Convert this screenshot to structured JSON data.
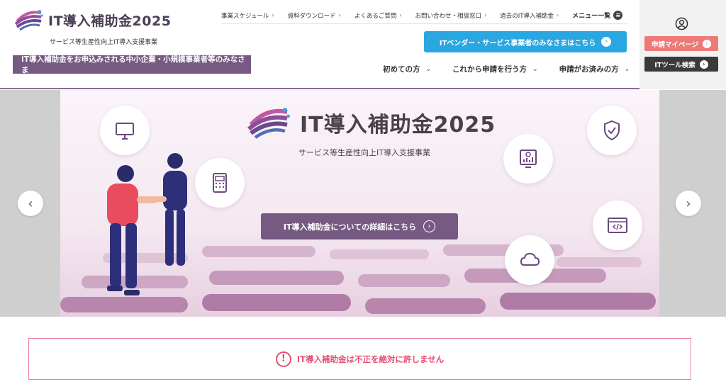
{
  "header": {
    "logo_text": "IT導入補助金2025",
    "logo_sub": "サービス等生産性向上IT導入支援事業",
    "audience_label": "IT導入補助金をお申込みされる中小企業・小規模事業者等のみなさま",
    "top_nav": [
      {
        "label": "事業スケジュール"
      },
      {
        "label": "資料ダウンロード"
      },
      {
        "label": "よくあるご質問"
      },
      {
        "label": "お問い合わせ・相談窓口"
      },
      {
        "label": "過去のIT導入補助金"
      }
    ],
    "menu_label": "メニュー一覧",
    "vendor_button": "ITベンダー・サービス事業者のみなさまはこちら",
    "main_nav": [
      {
        "label": "初めての方"
      },
      {
        "label": "これから申請を行う方"
      },
      {
        "label": "申請がお済みの方"
      }
    ],
    "mypage_button": "申請マイページ",
    "toolsearch_button": "ITツール検索"
  },
  "hero": {
    "title": "IT導入補助金2025",
    "subtitle": "サービス等生産性向上IT導入支援事業",
    "detail_button": "IT導入補助金についての詳細はこちら"
  },
  "notice": {
    "text": "IT導入補助金は不正を絶対に許しません"
  },
  "icons": {
    "account": "account-icon",
    "menu": "menu-icon",
    "prev": "chevron-left-icon",
    "next": "chevron-right-icon",
    "alert": "exclamation-icon"
  },
  "colors": {
    "brand_purple": "#765a82",
    "vendor_blue": "#2aa6e0",
    "mypage_pink": "#ee7a77",
    "notice_red": "#e84c76"
  }
}
